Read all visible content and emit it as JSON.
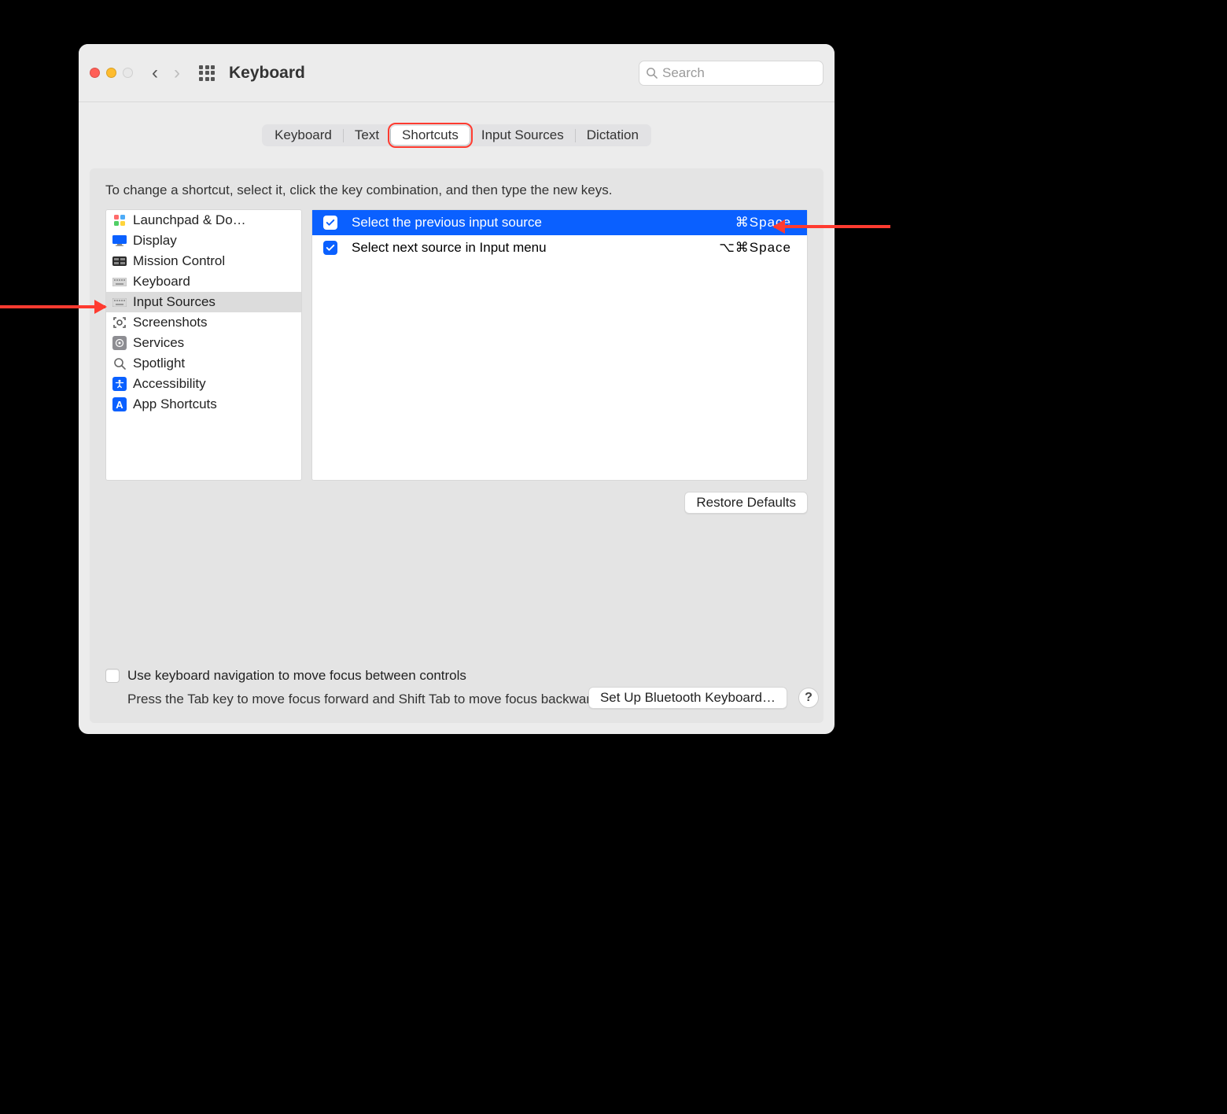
{
  "window": {
    "title": "Keyboard"
  },
  "search": {
    "placeholder": "Search"
  },
  "tabs": [
    {
      "label": "Keyboard"
    },
    {
      "label": "Text"
    },
    {
      "label": "Shortcuts",
      "active": true
    },
    {
      "label": "Input Sources"
    },
    {
      "label": "Dictation"
    }
  ],
  "hint": "To change a shortcut, select it, click the key combination, and then type the new keys.",
  "sidebar": [
    {
      "label": "Launchpad & Do…",
      "icon": "launchpad"
    },
    {
      "label": "Display",
      "icon": "display"
    },
    {
      "label": "Mission Control",
      "icon": "mission"
    },
    {
      "label": "Keyboard",
      "icon": "keyboard"
    },
    {
      "label": "Input Sources",
      "icon": "keyboard",
      "selected": true
    },
    {
      "label": "Screenshots",
      "icon": "screenshot"
    },
    {
      "label": "Services",
      "icon": "services"
    },
    {
      "label": "Spotlight",
      "icon": "spotlight"
    },
    {
      "label": "Accessibility",
      "icon": "accessibility"
    },
    {
      "label": "App Shortcuts",
      "icon": "app"
    }
  ],
  "detail": [
    {
      "label": "Select the previous input source",
      "key": "⌘Space",
      "checked": true,
      "selected": true
    },
    {
      "label": "Select next source in Input menu",
      "key": "⌥⌘Space",
      "checked": true
    }
  ],
  "restore_defaults": "Restore Defaults",
  "kb_nav": {
    "label": "Use keyboard navigation to move focus between controls",
    "hint": "Press the Tab key to move focus forward and Shift Tab to move focus backward."
  },
  "bluetooth_btn": "Set Up Bluetooth Keyboard…",
  "help": "?"
}
